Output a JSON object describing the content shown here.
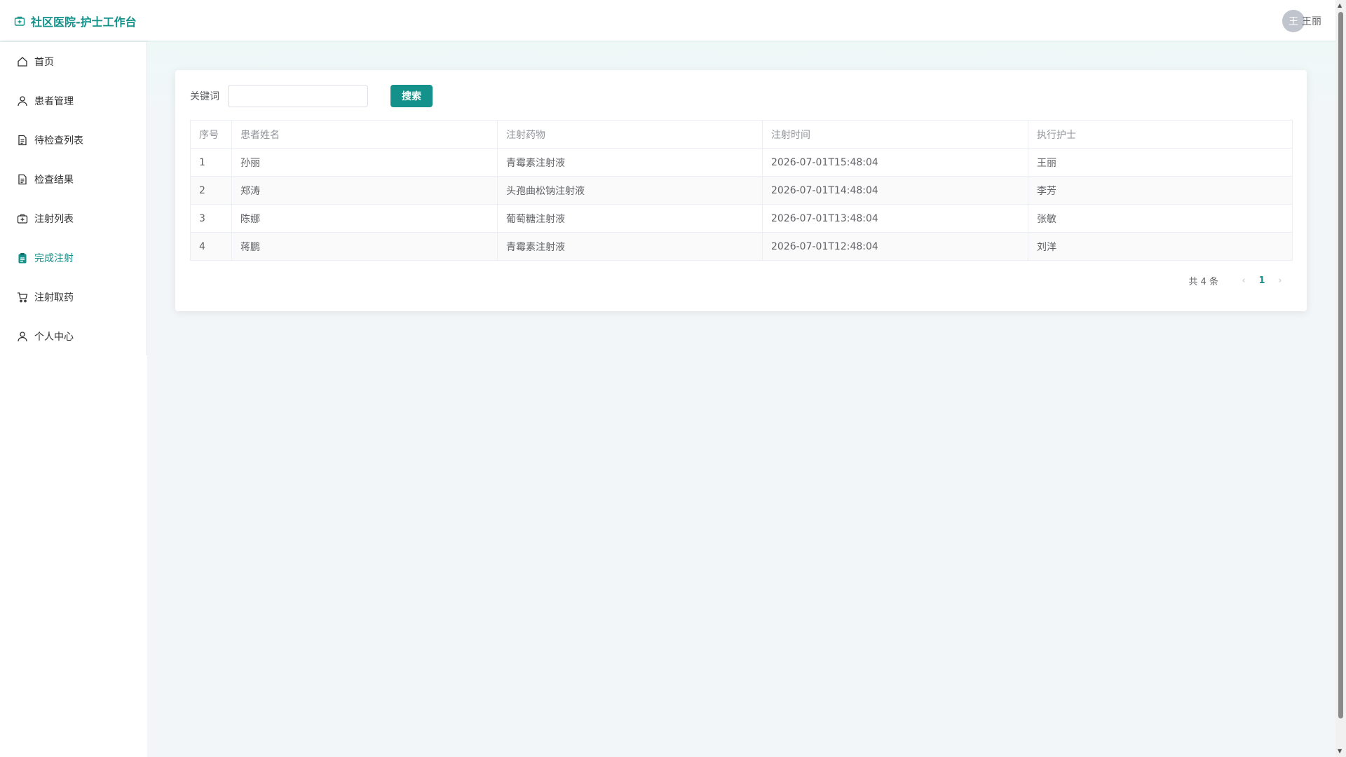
{
  "header": {
    "title": "社区医院-护士工作台",
    "user_avatar": "王",
    "user_name": "王丽"
  },
  "sidebar": {
    "items": [
      {
        "label": "首页",
        "icon": "home-icon"
      },
      {
        "label": "患者管理",
        "icon": "user-icon"
      },
      {
        "label": "待检查列表",
        "icon": "document-icon"
      },
      {
        "label": "检查结果",
        "icon": "document-icon"
      },
      {
        "label": "注射列表",
        "icon": "first-aid-kit-icon"
      },
      {
        "label": "完成注射",
        "icon": "clipboard-icon"
      },
      {
        "label": "注射取药",
        "icon": "cart-icon"
      },
      {
        "label": "个人中心",
        "icon": "user-icon"
      }
    ],
    "active_index": 5
  },
  "search": {
    "label": "关键词",
    "value": "",
    "placeholder": "",
    "button_label": "搜索"
  },
  "table": {
    "columns": [
      "序号",
      "患者姓名",
      "注射药物",
      "注射时间",
      "执行护士"
    ],
    "rows": [
      [
        "1",
        "孙丽",
        "青霉素注射液",
        "2026-07-01T15:48:04",
        "王丽"
      ],
      [
        "2",
        "郑涛",
        "头孢曲松钠注射液",
        "2026-07-01T14:48:04",
        "李芳"
      ],
      [
        "3",
        "陈娜",
        "葡萄糖注射液",
        "2026-07-01T13:48:04",
        "张敏"
      ],
      [
        "4",
        "蒋鹏",
        "青霉素注射液",
        "2026-07-01T12:48:04",
        "刘洋"
      ]
    ]
  },
  "pagination": {
    "total_label": "共 4 条",
    "current_page": "1",
    "prev": "‹",
    "next": "›"
  },
  "colors": {
    "accent": "#14918a",
    "background": "#f3f6f9",
    "text": "#606266"
  }
}
